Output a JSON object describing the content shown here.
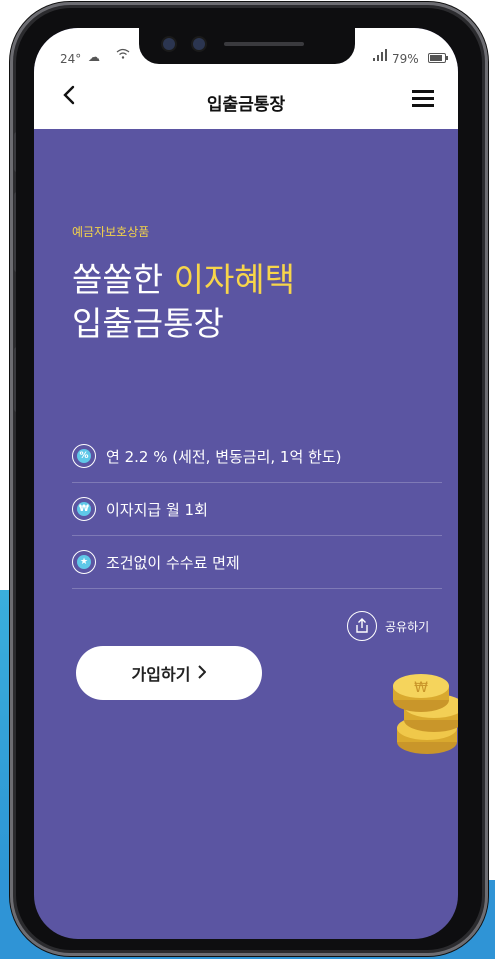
{
  "status_bar": {
    "temperature": "24°",
    "battery": "79%"
  },
  "header": {
    "title": "입출금통장"
  },
  "hero": {
    "eyebrow": "예금자보호상품",
    "headline_line1_prefix": "쏠쏠한 ",
    "headline_line1_highlight": "이자혜택",
    "headline_line2": "입출금통장"
  },
  "features": [
    {
      "icon": "percent-icon",
      "icon_glyph": "%",
      "text": "연 2.2 % (세전, 변동금리, 1억 한도)"
    },
    {
      "icon": "won-icon",
      "icon_glyph": "₩",
      "text": "이자지급 월 1회"
    },
    {
      "icon": "star-icon",
      "icon_glyph": "★",
      "text": "조건없이 수수료 면제"
    }
  ],
  "share": {
    "label": "공유하기"
  },
  "cta": {
    "label": "가입하기",
    "arrow": "›"
  },
  "colors": {
    "screen_bg": "#5b55a2",
    "accent_yellow": "#f7d54a",
    "icon_blue": "#5fc8e8"
  }
}
